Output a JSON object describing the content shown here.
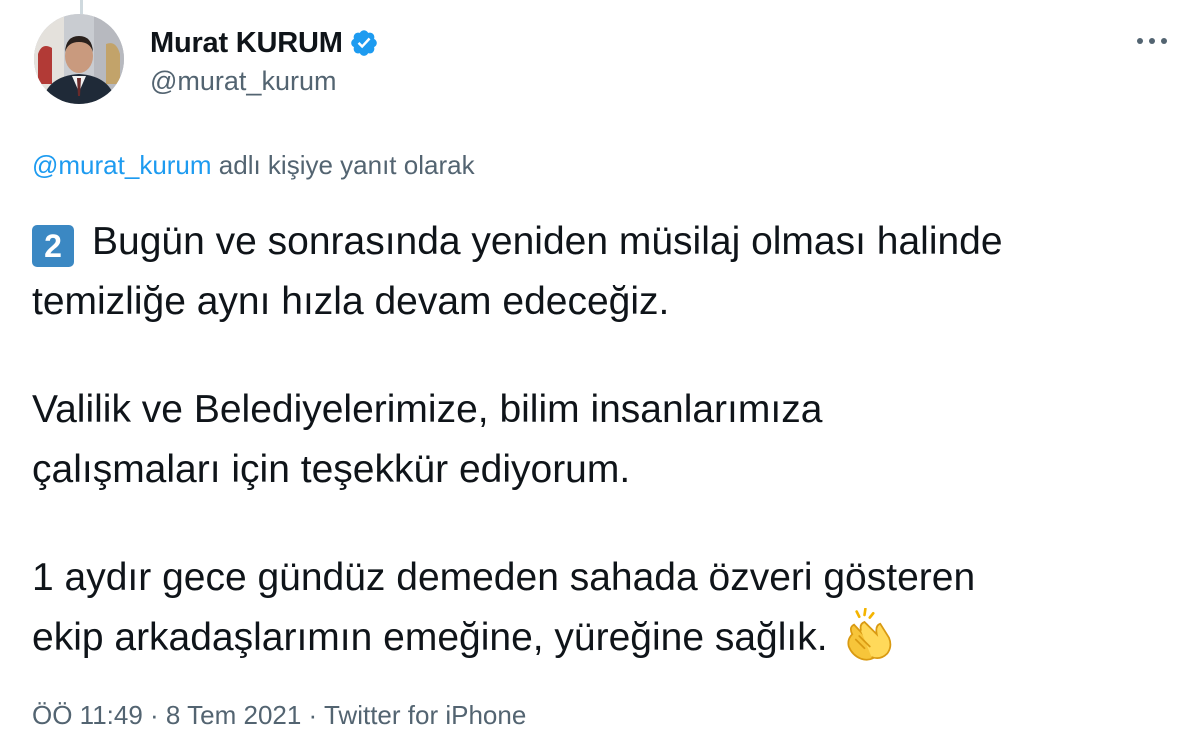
{
  "author": {
    "display_name": "Murat KURUM",
    "handle": "@murat_kurum",
    "verified": true
  },
  "reply": {
    "mention": "@murat_kurum",
    "suffix": " adlı kişiye yanıt olarak"
  },
  "tweet": {
    "keycap_number": "2",
    "paragraph1_line1": "Bugün ve sonrasında yeniden müsilaj olması halinde",
    "paragraph1_line2": "temizliğe aynı hızla devam edeceğiz.",
    "paragraph2_line1": "Valilik ve Belediyelerimize, bilim insanlarımıza",
    "paragraph2_line2": "çalışmaları için teşekkür ediyorum.",
    "paragraph3_line1": "1 aydır gece gündüz demeden sahada özveri gösteren",
    "paragraph3_line2": "ekip arkadaşlarımın emeğine, yüreğine sağlık.",
    "trailing_emoji": "clapping-hands"
  },
  "meta": {
    "time": "ÖÖ 11:49",
    "separator": " · ",
    "date": "8 Tem 2021",
    "source": "Twitter for iPhone"
  },
  "colors": {
    "link_blue": "#1d9bf0",
    "secondary_text": "#536471",
    "keycap_blue": "#3b88c3",
    "verified_blue": "#1d9bf0"
  }
}
